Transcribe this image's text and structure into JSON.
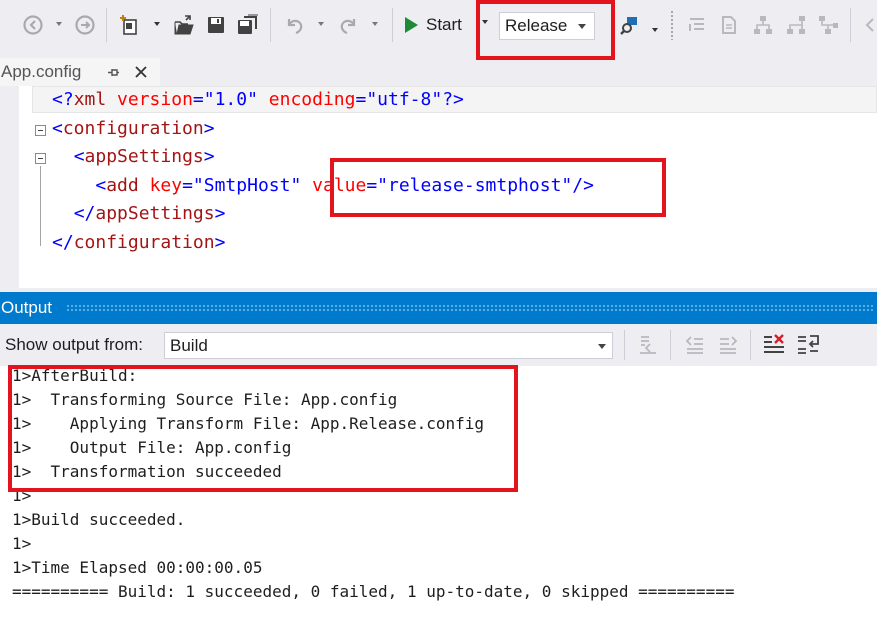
{
  "toolbar": {
    "start_label": "Start",
    "configuration_value": "Release",
    "icons": [
      "back-icon",
      "forward-icon",
      "new-project-icon",
      "open-file-icon",
      "save-icon",
      "save-all-icon",
      "undo-icon",
      "redo-icon",
      "start-icon",
      "find-in-files-icon"
    ]
  },
  "document_tab": {
    "label": "App.config"
  },
  "editor": {
    "line1": {
      "open": "<?",
      "decl": "xml",
      "attr1": "version",
      "eq1": "=",
      "val1": "\"1.0\"",
      "attr2": "encoding",
      "eq2": "=",
      "val2": "\"utf-8\"",
      "close": "?>"
    },
    "line2": {
      "open": "<",
      "tag": "configuration",
      "close": ">"
    },
    "line3": {
      "open": "<",
      "tag": "appSettings",
      "close": ">"
    },
    "line4": {
      "open": "<",
      "tag": "add",
      "attr1": "key",
      "eq1": "=",
      "val1": "\"SmtpHost\"",
      "attr2": "value",
      "eq2": "=",
      "val2": "\"release-smtphost\"",
      "close": "/>"
    },
    "line5": {
      "open": "</",
      "tag": "appSettings",
      "close": ">"
    },
    "line6": {
      "open": "</",
      "tag": "configuration",
      "close": ">"
    }
  },
  "output": {
    "title": "Output",
    "show_from_label": "Show output from:",
    "source_value": "Build",
    "lines": [
      "1>AfterBuild:",
      "1>  Transforming Source File: App.config",
      "1>    Applying Transform File: App.Release.config",
      "1>    Output File: App.config",
      "1>  Transformation succeeded",
      "1>",
      "1>Build succeeded.",
      "1>",
      "1>Time Elapsed 00:00:00.05",
      "========== Build: 1 succeeded, 0 failed, 1 up-to-date, 0 skipped =========="
    ]
  },
  "colors": {
    "accent": "#007acc",
    "highlight": "#e3141e",
    "start_green": "#1e8a35"
  }
}
